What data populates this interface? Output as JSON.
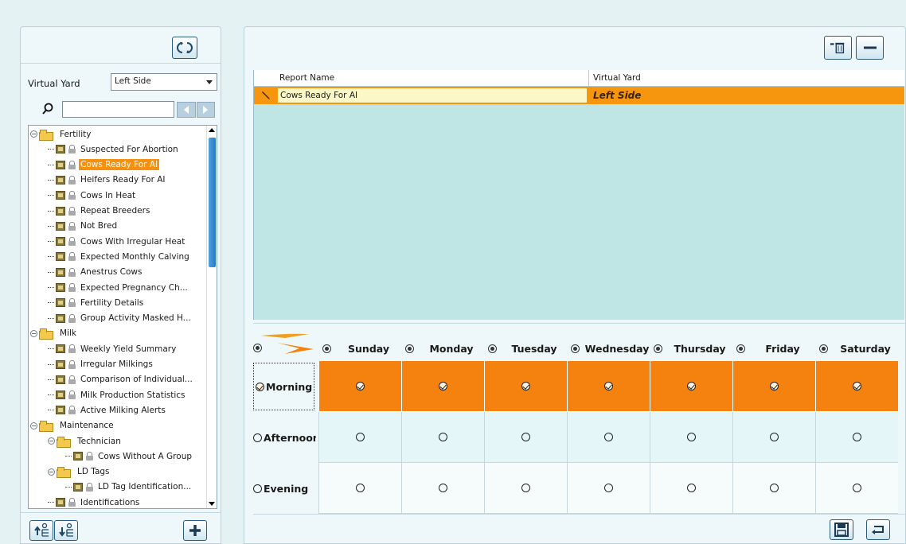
{
  "left_panel": {
    "virtual_yard_label": "Virtual Yard",
    "virtual_yard_value": "Left Side",
    "search_placeholder": "",
    "tree": [
      {
        "type": "folder",
        "label": "Fertility",
        "level": 0
      },
      {
        "type": "report",
        "label": "Suspected For Abortion",
        "level": 1
      },
      {
        "type": "report",
        "label": "Cows Ready For AI",
        "level": 1,
        "selected": true
      },
      {
        "type": "report",
        "label": "Heifers Ready For AI",
        "level": 1
      },
      {
        "type": "report",
        "label": "Cows In Heat",
        "level": 1
      },
      {
        "type": "report",
        "label": "Repeat Breeders",
        "level": 1
      },
      {
        "type": "report",
        "label": "Not Bred",
        "level": 1
      },
      {
        "type": "report",
        "label": "Cows With Irregular Heat",
        "level": 1
      },
      {
        "type": "report",
        "label": "Expected Monthly Calving",
        "level": 1
      },
      {
        "type": "report",
        "label": "Anestrus Cows",
        "level": 1
      },
      {
        "type": "report",
        "label": "Expected Pregnancy Ch...",
        "level": 1
      },
      {
        "type": "report",
        "label": "Fertility Details",
        "level": 1
      },
      {
        "type": "report",
        "label": "Group Activity Masked H...",
        "level": 1
      },
      {
        "type": "folder",
        "label": "Milk",
        "level": 0
      },
      {
        "type": "report",
        "label": "Weekly Yield Summary",
        "level": 1
      },
      {
        "type": "report",
        "label": "Irregular Milkings",
        "level": 1
      },
      {
        "type": "report",
        "label": "Comparison of Individual...",
        "level": 1
      },
      {
        "type": "report",
        "label": "Milk Production Statistics",
        "level": 1
      },
      {
        "type": "report",
        "label": "Active Milking Alerts",
        "level": 1
      },
      {
        "type": "folder",
        "label": "Maintenance",
        "level": 0
      },
      {
        "type": "folder",
        "label": "Technician",
        "level": 1
      },
      {
        "type": "report",
        "label": "Cows Without A Group",
        "level": 2
      },
      {
        "type": "folder",
        "label": "LD Tags",
        "level": 1
      },
      {
        "type": "report",
        "label": "LD Tag Identification...",
        "level": 2
      },
      {
        "type": "report",
        "label": "Identifications",
        "level": 1
      }
    ]
  },
  "report_grid": {
    "columns": [
      "Report Name",
      "Virtual Yard"
    ],
    "rows": [
      {
        "name": "Cows Ready For AI",
        "virtual_yard": "Left Side"
      }
    ]
  },
  "schedule": {
    "days": [
      "Sunday",
      "Monday",
      "Tuesday",
      "Wednesday",
      "Thursday",
      "Friday",
      "Saturday"
    ],
    "periods": [
      {
        "label": "Morning",
        "checked": true
      },
      {
        "label": "Afternoon",
        "checked": false
      },
      {
        "label": "Evening",
        "checked": false
      }
    ]
  },
  "colors": {
    "accent": "#f5820e",
    "panel_bg": "#eef7f9",
    "grid_bg": "#bfe5e5"
  }
}
